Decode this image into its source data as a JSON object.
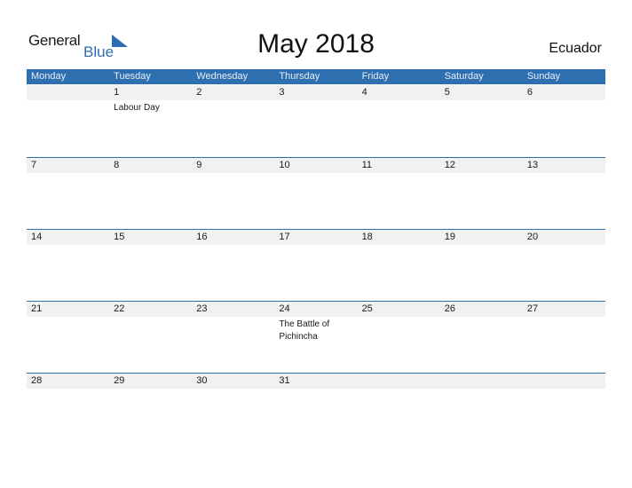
{
  "logo": {
    "general": "General",
    "blue": "Blue"
  },
  "title": "May 2018",
  "country": "Ecuador",
  "colors": {
    "accent": "#2e6fb0",
    "strip": "#f1f1f1"
  },
  "days": [
    "Monday",
    "Tuesday",
    "Wednesday",
    "Thursday",
    "Friday",
    "Saturday",
    "Sunday"
  ],
  "weeks": [
    [
      {
        "d": ""
      },
      {
        "d": "1",
        "e": "Labour Day"
      },
      {
        "d": "2"
      },
      {
        "d": "3"
      },
      {
        "d": "4"
      },
      {
        "d": "5"
      },
      {
        "d": "6"
      }
    ],
    [
      {
        "d": "7"
      },
      {
        "d": "8"
      },
      {
        "d": "9"
      },
      {
        "d": "10"
      },
      {
        "d": "11"
      },
      {
        "d": "12"
      },
      {
        "d": "13"
      }
    ],
    [
      {
        "d": "14"
      },
      {
        "d": "15"
      },
      {
        "d": "16"
      },
      {
        "d": "17"
      },
      {
        "d": "18"
      },
      {
        "d": "19"
      },
      {
        "d": "20"
      }
    ],
    [
      {
        "d": "21"
      },
      {
        "d": "22"
      },
      {
        "d": "23"
      },
      {
        "d": "24",
        "e": "The Battle of Pichincha"
      },
      {
        "d": "25"
      },
      {
        "d": "26"
      },
      {
        "d": "27"
      }
    ],
    [
      {
        "d": "28"
      },
      {
        "d": "29"
      },
      {
        "d": "30"
      },
      {
        "d": "31"
      },
      {
        "d": ""
      },
      {
        "d": ""
      },
      {
        "d": ""
      }
    ]
  ]
}
